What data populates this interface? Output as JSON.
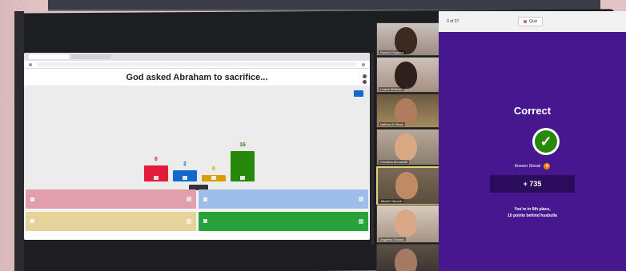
{
  "presentation": {
    "question": "God asked Abraham to sacrifice...",
    "bar_counts": [
      "6",
      "2",
      "0",
      "16"
    ],
    "bar_colors": [
      "#e21b3c",
      "#1368ce",
      "#d89e00",
      "#26890c"
    ]
  },
  "kahoot": {
    "progress": "3 of 27",
    "mode_label": "Quiz",
    "result": "Correct",
    "streak_label": "Answer Streak",
    "streak_value": "4",
    "points": "+ 735",
    "place_line1": "You're in 6th place,",
    "place_line2": "10 points behind husbulla"
  },
  "participants": [
    "Rachel Chaihout",
    "Lusine Melikian",
    "Nathan Al Shaia",
    "Christina Mouawad",
    "Michel Yacoub",
    "Angelina Tarazia",
    ""
  ]
}
